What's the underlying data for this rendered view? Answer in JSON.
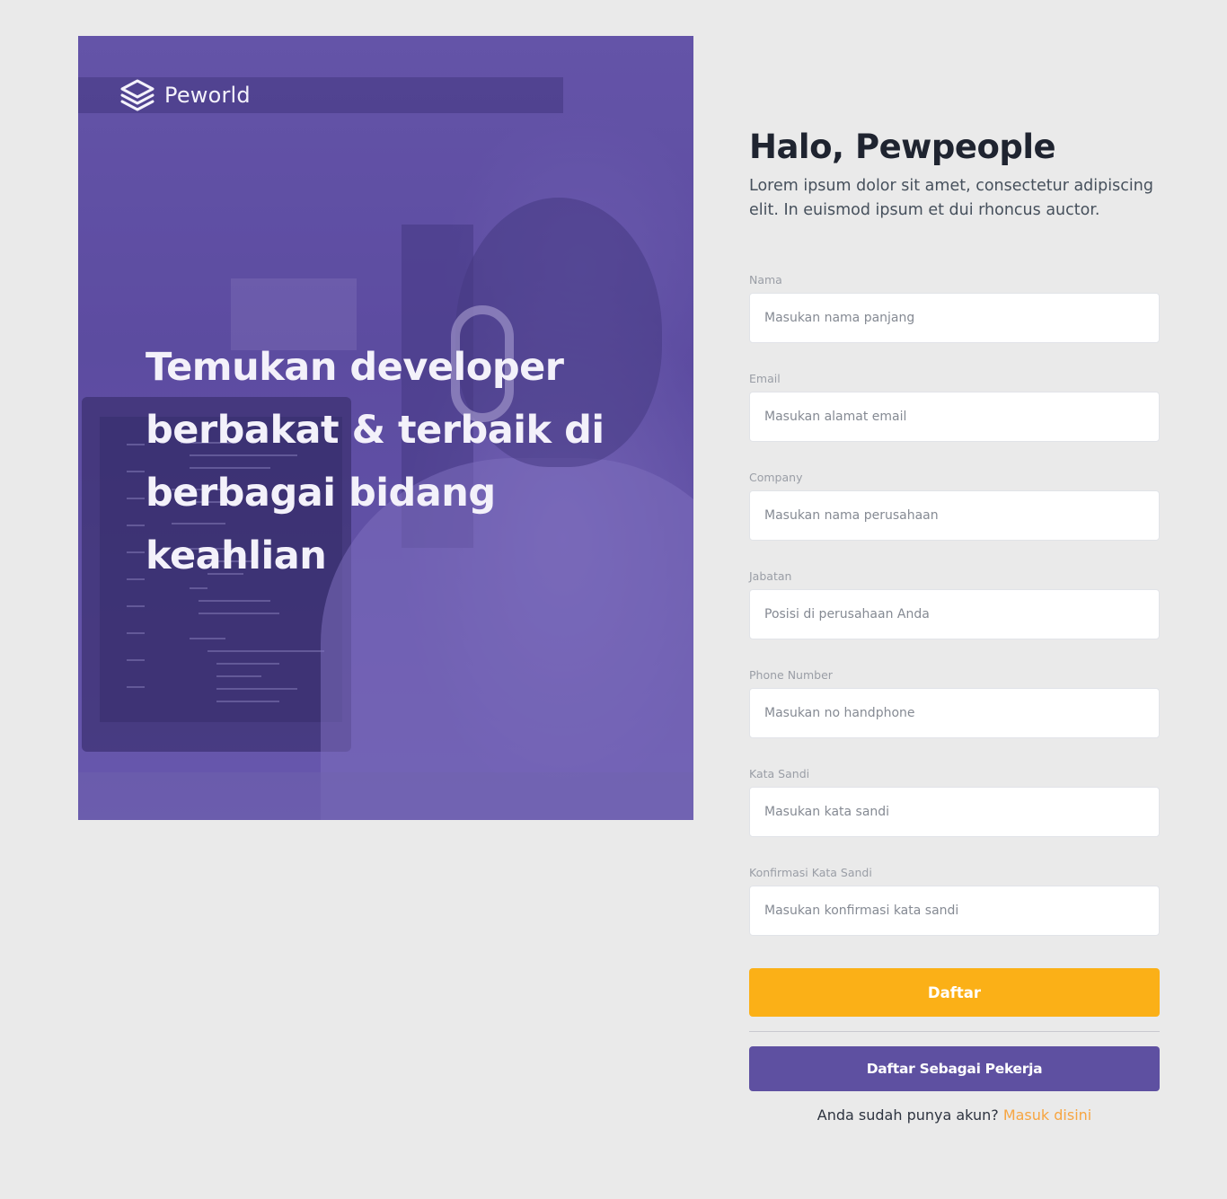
{
  "brand": {
    "name": "Peworld",
    "logo_icon": "stacked-layers-icon"
  },
  "hero": {
    "headline": "Temukan developer berbakat & terbaik di berbagai bidang keahlian"
  },
  "form": {
    "title": "Halo, Pewpeople",
    "subtitle": "Lorem ipsum dolor sit amet, consectetur adipiscing elit. In euismod ipsum et dui rhoncus auctor.",
    "fields": [
      {
        "label": "Nama",
        "placeholder": "Masukan nama panjang",
        "value": ""
      },
      {
        "label": "Email",
        "placeholder": "Masukan alamat email",
        "value": ""
      },
      {
        "label": "Company",
        "placeholder": "Masukan nama perusahaan",
        "value": ""
      },
      {
        "label": "Jabatan",
        "placeholder": "Posisi di perusahaan Anda",
        "value": ""
      },
      {
        "label": "Phone Number",
        "placeholder": "Masukan no handphone",
        "value": ""
      },
      {
        "label": "Kata Sandi",
        "placeholder": "Masukan kata sandi",
        "value": ""
      },
      {
        "label": "Konfirmasi Kata Sandi",
        "placeholder": "Masukan konfirmasi kata sandi",
        "value": ""
      }
    ],
    "submit_label": "Daftar",
    "worker_signup_label": "Daftar Sebagai Pekerja",
    "login_prompt": "Anda sudah punya akun?",
    "login_link": "Masuk disini"
  },
  "colors": {
    "background": "#eaeaea",
    "primary_button": "#fbb017",
    "secondary_button": "#5e50a1",
    "link": "#f7a541",
    "hero_tint": "#5f4fa2"
  }
}
